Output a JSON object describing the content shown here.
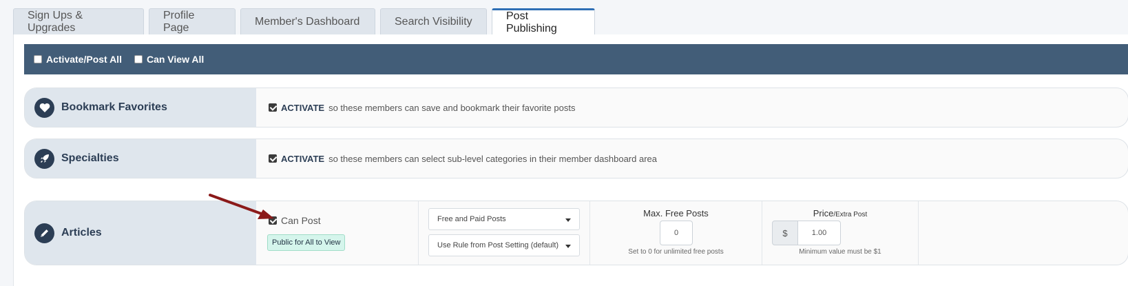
{
  "tabs": [
    {
      "label": "Sign Ups & Upgrades",
      "active": false
    },
    {
      "label": "Profile Page",
      "active": false
    },
    {
      "label": "Member's Dashboard",
      "active": false
    },
    {
      "label": "Search Visibility",
      "active": false
    },
    {
      "label": "Post Publishing",
      "active": true
    }
  ],
  "toolbar": {
    "activate_all_label": "Activate/Post All",
    "activate_all_checked": false,
    "view_all_label": "Can View All",
    "view_all_checked": false
  },
  "rows": {
    "bookmark": {
      "title": "Bookmark Favorites",
      "icon": "heart-icon",
      "checked": true,
      "strong": "ACTIVATE",
      "text": "so these members can save and bookmark their favorite posts"
    },
    "specialties": {
      "title": "Specialties",
      "icon": "rocket-icon",
      "checked": true,
      "strong": "ACTIVATE",
      "text": "so these members can select sub-level categories in their member dashboard area"
    },
    "articles": {
      "title": "Articles",
      "icon": "pencil-icon",
      "can_post_label": "Can Post",
      "can_post_checked": true,
      "visibility_badge": "Public for All to View",
      "post_type_select": "Free and Paid Posts",
      "rule_select": "Use Rule from Post Setting (default)",
      "max_free_label": "Max. Free Posts",
      "max_free_value": "0",
      "max_free_hint": "Set to 0 for unlimited free posts",
      "price_label": "Price",
      "price_sublabel": "/Extra Post",
      "currency_symbol": "$",
      "price_value": "1.00",
      "price_hint": "Minimum value must be $1"
    }
  },
  "colors": {
    "toolbar_bg": "#425d78",
    "tab_active_border": "#2f6fb5",
    "icon_bg": "#2c3e55",
    "arrow": "#8b1a1a",
    "badge_bg": "#d5f5ec"
  }
}
